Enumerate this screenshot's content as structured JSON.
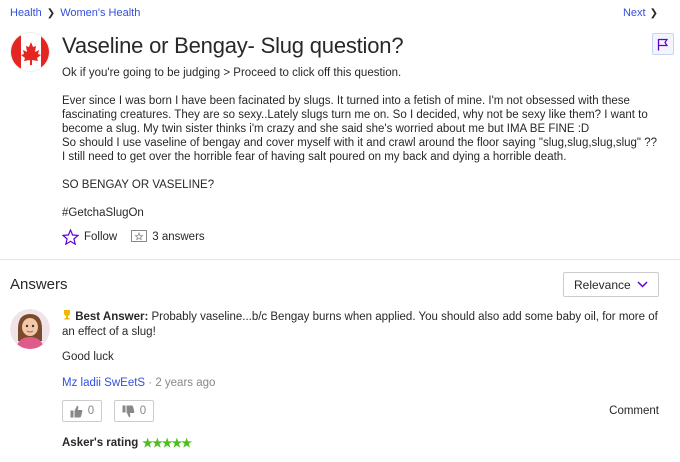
{
  "breadcrumb": {
    "category": "Health",
    "subcategory": "Women's Health"
  },
  "nav": {
    "next": "Next"
  },
  "question": {
    "title": "Vaseline or Bengay- Slug question?",
    "line1": "Ok if you're going to be judging > Proceed to click off this question.",
    "line2": "Ever since I was born I have been facinated by slugs. It turned into a fetish of mine. I'm not obsessed with these fascinating creatures. They are so sexy..Lately slugs turn me on. So I decided, why not be sexy like them? I want to become a slug. My twin sister thinks i'm crazy and she said she's worried about me but IMA BE FINE :D",
    "line3": "So should I use vaseline of bengay and cover myself with it and crawl around the floor saying \"slug,slug,slug,slug\" ??",
    "line4": "I still need to get over the horrible fear of having salt poured on my back and dying a horrible death.",
    "line5": "SO BENGAY OR VASELINE?",
    "line6": "#GetchaSlugOn",
    "follow": "Follow",
    "answers_count": "3 answers"
  },
  "answers": {
    "heading": "Answers",
    "sort": "Relevance"
  },
  "best_answer": {
    "label": "Best Answer:",
    "text": "Probably vaseline...b/c Bengay burns when applied. You should also add some baby oil, for more of an effect of a slug!",
    "extra": "Good luck",
    "user": "Mz ladii SwEetS",
    "time": "· 2 years ago",
    "upvotes": "0",
    "downvotes": "0",
    "comment": "Comment",
    "rating_label": "Asker's rating",
    "rating_value": 5,
    "rating_stars": "★★★★★"
  },
  "colors": {
    "link": "#324fe1",
    "accent": "#6001d2",
    "star": "#4bbf1d"
  }
}
